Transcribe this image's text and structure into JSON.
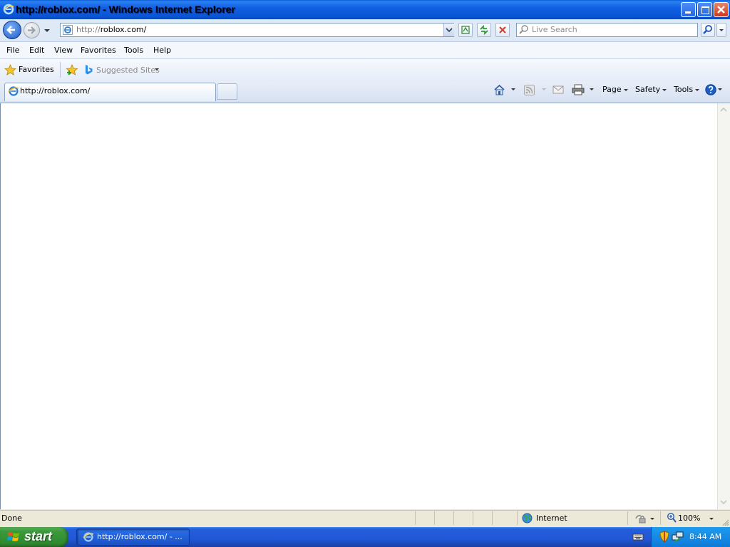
{
  "window": {
    "title": "http://roblox.com/ - Windows Internet Explorer"
  },
  "navigation": {
    "address_prefix": "http://",
    "address_host": "roblox.com/",
    "search_placeholder": "Live Search"
  },
  "menu": {
    "items": [
      "File",
      "Edit",
      "View",
      "Favorites",
      "Tools",
      "Help"
    ]
  },
  "favorites_bar": {
    "favorites_label": "Favorites",
    "suggested_sites_label": "Suggested Sites"
  },
  "tabs": [
    {
      "label": "http://roblox.com/"
    }
  ],
  "command_bar": {
    "page_label": "Page",
    "safety_label": "Safety",
    "tools_label": "Tools"
  },
  "status_bar": {
    "status_text": "Done",
    "zone": "Internet",
    "zoom": "100%"
  },
  "taskbar": {
    "start_label": "start",
    "task_label": "http://roblox.com/ - ...",
    "clock": "8:44 AM"
  },
  "colors": {
    "titlebar": "#0a55d5",
    "taskbar": "#245edb",
    "start_button": "#3c9a3c"
  }
}
